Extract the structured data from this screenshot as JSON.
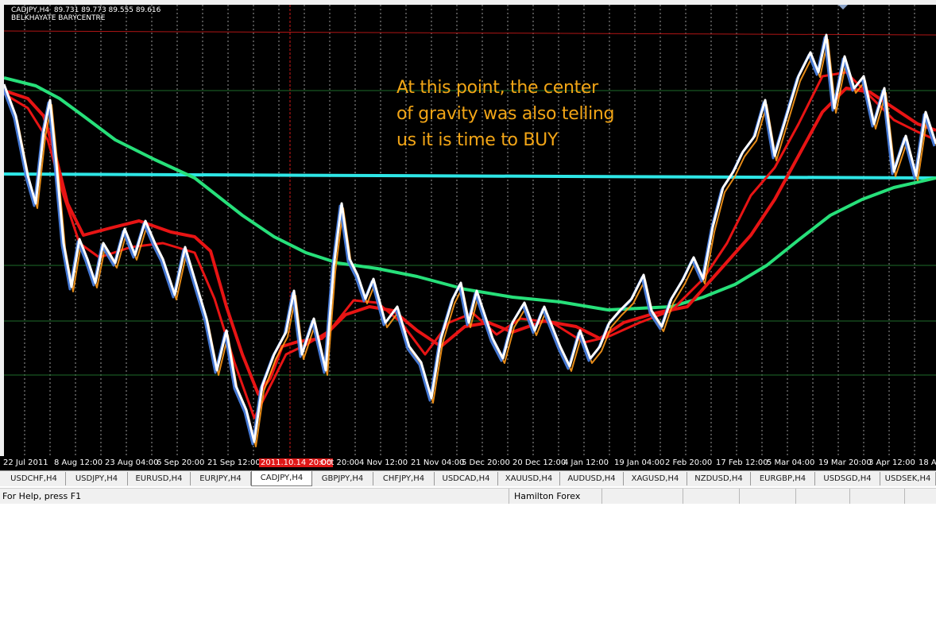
{
  "chart": {
    "symbol_line": "CADJPY,H4  89.731 89.773 89.555 89.616",
    "indicator_line": "BELKHAYATE BARYCENTRE",
    "annotation_lines": [
      "At this point, the center",
      "of gravity was also telling",
      "us it is time to BUY"
    ],
    "annotation_color": "#f2a516",
    "background_color": "#000000",
    "time_axis": [
      "22 Jul 2011",
      "8 Aug 12:00",
      "23 Aug 04:00",
      "6 Sep 20:00",
      "21 Sep 12:00",
      "2011.10.14 20:00",
      "Oct 20:00",
      "4 Nov 12:00",
      "21 Nov 04:00",
      "5 Dec 20:00",
      "20 Dec 12:00",
      "4 Jan 12:00",
      "19 Jan 04:00",
      "2 Feb 20:00",
      "17 Feb 12:00",
      "5 Mar 04:00",
      "19 Mar 20:00",
      "3 Apr 12:00",
      "18 Ap"
    ],
    "highlighted_time_label": "2011.10.14 20:00",
    "horizontal_level_color": "#2ee6e6",
    "long_average_color": "#27e07a",
    "average_color": "#e81414",
    "price_color": "#ffffff"
  },
  "tabs": [
    {
      "label": "USDCHF,H4",
      "active": false
    },
    {
      "label": "USDJPY,H4",
      "active": false
    },
    {
      "label": "EURUSD,H4",
      "active": false
    },
    {
      "label": "EURJPY,H4",
      "active": false
    },
    {
      "label": "CADJPY,H4",
      "active": true
    },
    {
      "label": "GBPJPY,H4",
      "active": false
    },
    {
      "label": "CHFJPY,H4",
      "active": false
    },
    {
      "label": "USDCAD,H4",
      "active": false
    },
    {
      "label": "XAUUSD,H4",
      "active": false
    },
    {
      "label": "AUDUSD,H4",
      "active": false
    },
    {
      "label": "XAGUSD,H4",
      "active": false
    },
    {
      "label": "NZDUSD,H4",
      "active": false
    },
    {
      "label": "EURGBP,H4",
      "active": false
    },
    {
      "label": "USDSGD,H4",
      "active": false
    },
    {
      "label": "USDSEK,H4",
      "active": false
    }
  ],
  "status": {
    "help_text": "For Help, press F1",
    "server": "Hamilton Forex"
  }
}
